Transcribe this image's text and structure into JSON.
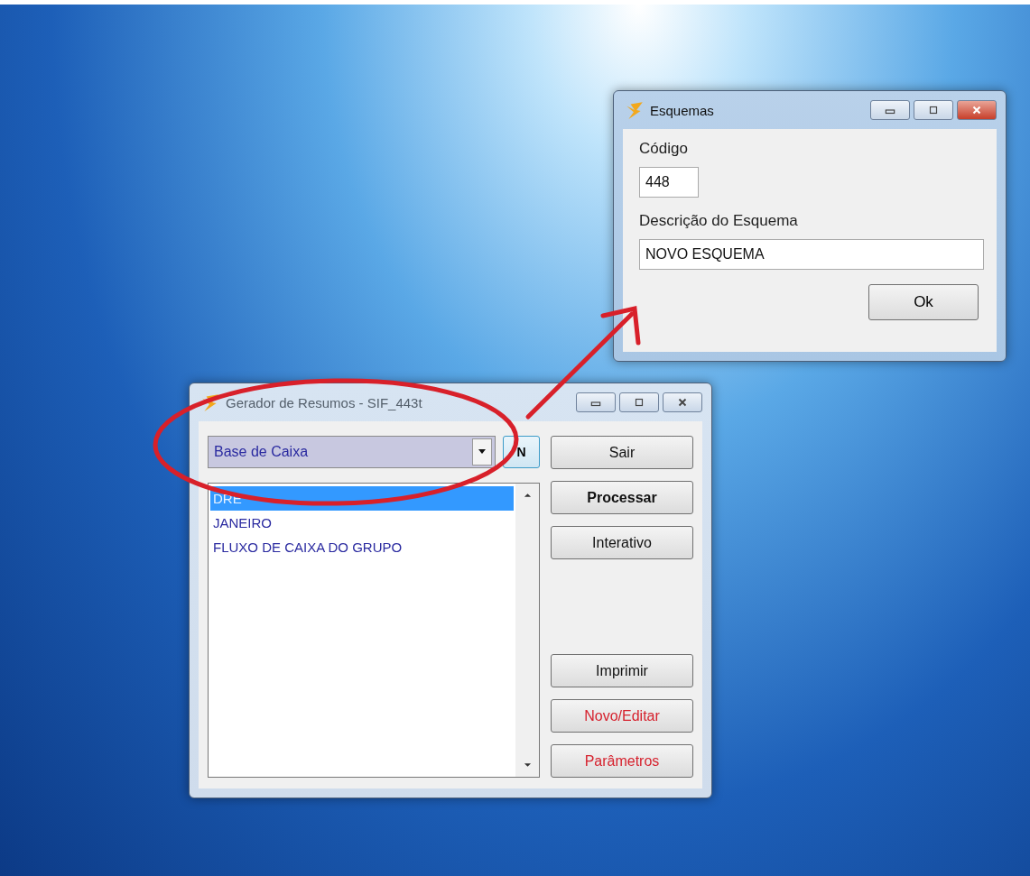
{
  "windows": [
    {
      "title": "Gerador de Resumos - SIF_443t",
      "active": false,
      "combo": {
        "value": "Base de Caixa"
      },
      "side_button": "N",
      "list": [
        {
          "label": "DRE",
          "selected": true
        },
        {
          "label": "JANEIRO",
          "selected": false
        },
        {
          "label": "FLUXO DE CAIXA DO GRUPO",
          "selected": false
        }
      ],
      "buttons_top": [
        {
          "label": "Sair",
          "kind": "normal"
        },
        {
          "label": "Processar",
          "kind": "bold"
        },
        {
          "label": "Interativo",
          "kind": "normal"
        }
      ],
      "buttons_bottom": [
        {
          "label": "Imprimir",
          "kind": "normal"
        },
        {
          "label": "Novo/Editar",
          "kind": "alert"
        },
        {
          "label": "Parâmetros",
          "kind": "alert"
        }
      ]
    },
    {
      "title": "Esquemas",
      "active": true,
      "fields": [
        {
          "label": "Código",
          "value": "448",
          "kind": "short"
        },
        {
          "label": "Descrição do Esquema",
          "value": "NOVO ESQUEMA",
          "kind": "wide"
        }
      ],
      "ok_button": "Ok"
    }
  ]
}
